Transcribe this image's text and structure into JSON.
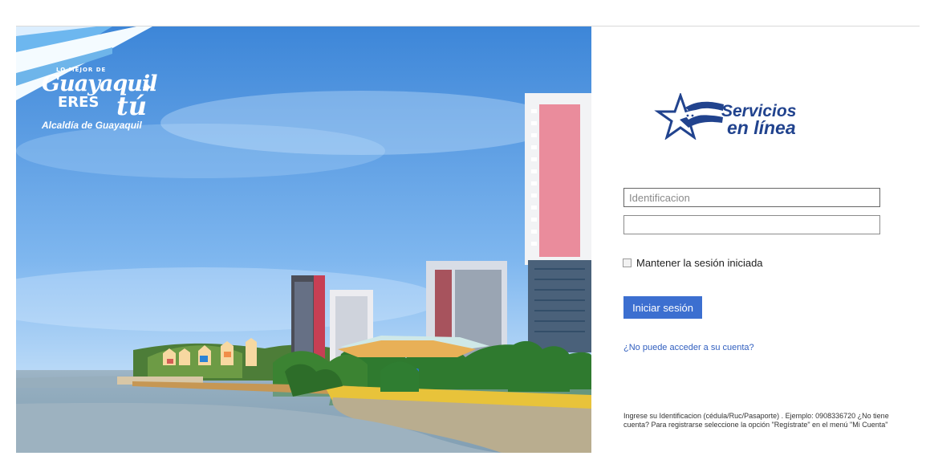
{
  "hero": {
    "brand": {
      "eyebrow": "LO MEJOR DE",
      "script": "Guayaquil",
      "eres": "ERES",
      "tu": "tú",
      "city": "Alcaldía de Guayaquil"
    }
  },
  "logo": {
    "line1": "Servicios",
    "line2": "en línea",
    "icon": "star-flag-icon"
  },
  "form": {
    "identification_placeholder": "Identificacion",
    "identification_value": "",
    "password_value": "",
    "remember_label": "Mantener la sesión iniciada",
    "submit_label": "Iniciar sesión",
    "forgot_label": "¿No puede acceder a su cuenta?"
  },
  "help_text": "Ingrese su Identificacion (cédula/Ruc/Pasaporte) . Ejemplo: 0908336720 ¿No tiene cuenta? Para registrarse seleccione la opción \"Regístrate\" en el menú \"Mi Cuenta\"",
  "colors": {
    "accent": "#3c6fd0",
    "brand_blue": "#21438e",
    "sky": "#3f8fd6"
  }
}
